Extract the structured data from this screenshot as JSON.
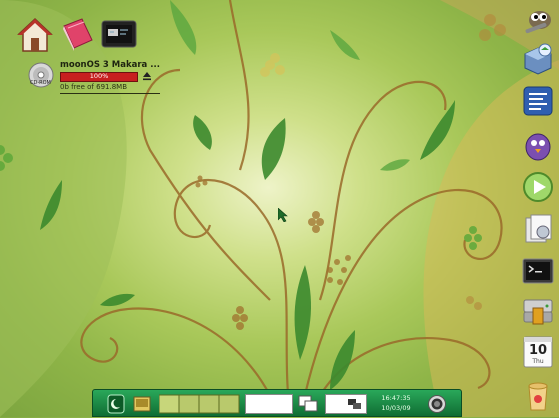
{
  "desktop": {
    "icons": [
      {
        "name": "home",
        "icon": "home-icon"
      },
      {
        "name": "book",
        "icon": "book-icon"
      },
      {
        "name": "monitor",
        "icon": "monitor-icon"
      }
    ]
  },
  "volume": {
    "title": "moonOS 3 Makara ...",
    "usage_percent_label": "100%",
    "usage_fraction": 1.0,
    "free_text": "0b free of 691.8MB",
    "disc_label": "CD-ROM",
    "bar_color": "#c71f1f"
  },
  "dock": {
    "items": [
      {
        "icon": "gimp-icon"
      },
      {
        "icon": "package-icon"
      },
      {
        "icon": "writer-icon"
      },
      {
        "icon": "pidgin-icon"
      },
      {
        "icon": "play-icon"
      },
      {
        "icon": "files-icon"
      },
      {
        "icon": "terminal-icon"
      },
      {
        "icon": "hard-drive-icon"
      },
      {
        "icon": "calendar-icon"
      },
      {
        "icon": "trash-icon"
      }
    ],
    "calendar_day": "10",
    "calendar_weekday": "Thu"
  },
  "panel": {
    "time": "16:47:35",
    "date": "10/03/09",
    "accent": "#1e8c45"
  }
}
